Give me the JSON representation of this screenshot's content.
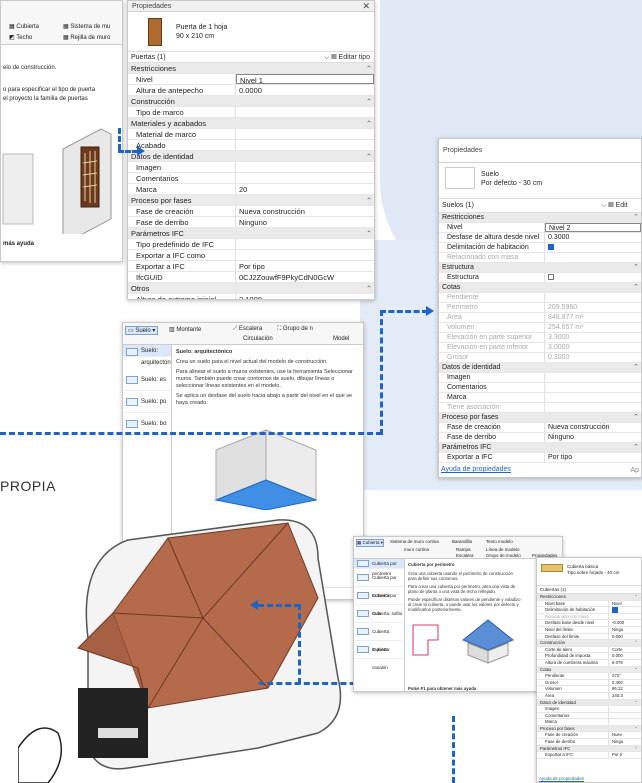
{
  "background": {
    "accent": "#1e63c8",
    "blob": "#dfe8f4"
  },
  "left_partial": {
    "toolbar": {
      "cubierta": "Cubierta",
      "sistema": "Sistema de mu",
      "techo": "Techo",
      "rejilla": "Rejilla de muro"
    },
    "line1": "elo de construcción.",
    "line2": "o para especificar el tipo de puerta",
    "line3": "el proyecto la familia de puertas",
    "help": "más ayuda"
  },
  "door_panel": {
    "title": "Propiedades",
    "type_name": "Puerta de 1 hoja",
    "type_size": "90 x 210 cm",
    "selector": "Puertas (1)",
    "edit_type": "Editar tipo",
    "rows": [
      {
        "g": "Restricciones"
      },
      {
        "k": "Nivel",
        "v": "Nivel 1",
        "edit": true
      },
      {
        "k": "Altura de antepecho",
        "v": "0.0000"
      },
      {
        "g": "Construcción"
      },
      {
        "k": "Tipo de marco",
        "v": ""
      },
      {
        "g": "Materiales y acabados"
      },
      {
        "k": "Material de marco",
        "v": ""
      },
      {
        "k": "Acabado",
        "v": ""
      },
      {
        "g": "Datos de identidad"
      },
      {
        "k": "Imagen",
        "v": ""
      },
      {
        "k": "Comentarios",
        "v": ""
      },
      {
        "k": "Marca",
        "v": "20"
      },
      {
        "g": "Proceso por fases"
      },
      {
        "k": "Fase de creación",
        "v": "Nueva construcción"
      },
      {
        "k": "Fase de derribo",
        "v": "Ninguno"
      },
      {
        "g": "Parámetros IFC"
      },
      {
        "k": "Tipo predefinido de IFC",
        "v": ""
      },
      {
        "k": "Exportar a IFC como",
        "v": ""
      },
      {
        "k": "Exportar a IFC",
        "v": "Por tipo"
      },
      {
        "k": "IfcGUID",
        "v": "0CJ2ZouwfF9PkyCdN0GcW"
      },
      {
        "g": "Otros"
      },
      {
        "k": "Altura de extremo inicial",
        "v": "2.1000"
      }
    ]
  },
  "floor_panel": {
    "title": "Propiedades",
    "type_name": "Suelo",
    "type_sub": "Por defecto - 30 cm",
    "selector": "Suelos (1)",
    "edit_type": "Edit",
    "rows": [
      {
        "g": "Restricciones"
      },
      {
        "k": "Nivel",
        "v": "Nivel 2",
        "edit": true
      },
      {
        "k": "Desfase de altura desde nivel",
        "v": "0.3000"
      },
      {
        "k": "Delimitación de habitación",
        "chk": true
      },
      {
        "k": "Relacionado con masa",
        "v": "",
        "dim": true
      },
      {
        "g": "Estructura"
      },
      {
        "k": "Estructura",
        "chk": false
      },
      {
        "g": "Cotas"
      },
      {
        "k": "Pendiente",
        "v": "",
        "dim": true
      },
      {
        "k": "Perímetro",
        "v": "209.5960",
        "dim": true
      },
      {
        "k": "Área",
        "v": "848.877 m²",
        "dim": true
      },
      {
        "k": "Volumen",
        "v": "254.657 m³",
        "dim": true
      },
      {
        "k": "Elevación en parte superior",
        "v": "3.3000",
        "dim": true
      },
      {
        "k": "Elevación en parte inferior",
        "v": "3.0000",
        "dim": true
      },
      {
        "k": "Grosor",
        "v": "0.3000",
        "dim": true
      },
      {
        "g": "Datos de identidad"
      },
      {
        "k": "Imagen",
        "v": ""
      },
      {
        "k": "Comentarios",
        "v": ""
      },
      {
        "k": "Marca",
        "v": ""
      },
      {
        "k": "Tiene asociación",
        "v": "",
        "dim": true
      },
      {
        "g": "Proceso por fases"
      },
      {
        "k": "Fase de creación",
        "v": "Nueva construcción"
      },
      {
        "k": "Fase de derribo",
        "v": "Ninguno"
      },
      {
        "g": "Parámetros IFC"
      },
      {
        "k": "Exportar a IFC",
        "v": "Por tipo"
      }
    ],
    "help_link": "Ayuda de propiedades",
    "apply": "Ap"
  },
  "floor_tool": {
    "toolbar": {
      "suelo": "Suelo",
      "montante": "Montante",
      "escalera": "Escalera",
      "grupo": "Grupo de n",
      "circulacion": "Circulación",
      "model": "Model"
    },
    "menu": [
      "Suelo: arquitectónico",
      "Suelo: es",
      "Suelo: po",
      "Suelo: bo"
    ],
    "tip_title": "Suelo: arquitectónico",
    "tip_p1": "Crea un suelo para el nivel actual del modelo de construcción.",
    "tip_p2": "Para alinear el suelo a muros existentes, use la herramienta Seleccionar muros. También puede crear contornos de suelo, dibujar líneas o seleccionar líneas existentes en el modelo.",
    "tip_p3": "Se aplica un desfase del suelo hacia abajo a partir del nivel en el que se haya creado.",
    "tip_footer": "Pulse F1 para obtener más ayuda"
  },
  "roof_tool": {
    "toolbar": {
      "cubierta": "Cubierta",
      "sistema": "Sistema de muro cortina",
      "baranda": "Barandilla",
      "texto": "Texto modelo",
      "rampa": "Rampa",
      "linea": "Línea de modelo",
      "muro": "muro cortina",
      "escalera": "Escalera",
      "grupo": "Grupo de modelo",
      "propiedades": "Propiedades"
    },
    "menu": [
      "Cubierta por perímetro",
      "Cubierta por extrusión",
      "Cubierta por cara",
      "Cubierta: sofito",
      "Cubierta: imposta",
      "Cubierta: canalón"
    ],
    "tip_title": "Cubierta por perímetro",
    "tip_p1": "Crea una cubierta usando el perímetro de construcción para definir sus contornos.",
    "tip_p2": "Para crear una cubierta por perímetro, abra una vista de plano de planta o una vista de techo reflejado.",
    "tip_p3": "Puede especificar distintos valores de pendiente y voladizo al crear la cubierta, o puede usar los valores por defecto y modificarlos posteriormente.",
    "tip_footer": "Pulse F1 para obtener más ayuda"
  },
  "roof_panel": {
    "type_name": "Cubierta básica",
    "type_sub": "Tipo sobre forjado - 40 cm",
    "selector": "Cubiertas (1)",
    "rows": [
      {
        "g": "Restricciones"
      },
      {
        "k": "Nivel base",
        "v": "Nivel"
      },
      {
        "k": "Delimitación de habitación",
        "chk": true
      },
      {
        "k": "Relacionado con masa",
        "v": "",
        "dim": true
      },
      {
        "k": "Desfase base desde nivel",
        "v": "-0.000"
      },
      {
        "k": "Nivel del límite",
        "v": "Ningu"
      },
      {
        "k": "Desfase del límite",
        "v": "0.000"
      },
      {
        "g": "Construcción"
      },
      {
        "k": "Corte de alero",
        "v": "Corte"
      },
      {
        "k": "Profundidad de imposta",
        "v": "0.000"
      },
      {
        "k": "Altura de cumbrera máxima",
        "v": "8.078"
      },
      {
        "g": "Cotas"
      },
      {
        "k": "Pendiente",
        "v": "272°"
      },
      {
        "k": "Grosor",
        "v": "0.400"
      },
      {
        "k": "Volumen",
        "v": "96.12"
      },
      {
        "k": "Área",
        "v": "240.3"
      },
      {
        "g": "Datos de identidad"
      },
      {
        "k": "Imagen",
        "v": ""
      },
      {
        "k": "Comentarios",
        "v": ""
      },
      {
        "k": "Marca",
        "v": ""
      },
      {
        "g": "Proceso por fases"
      },
      {
        "k": "Fase de creación",
        "v": "Nuev"
      },
      {
        "k": "Fase de derribo",
        "v": "Ningu"
      },
      {
        "g": "Parámetros IFC"
      },
      {
        "k": "Exportar a IFC",
        "v": "Por ti"
      }
    ],
    "help_link": "Ayuda de propiedades"
  },
  "caption": "PROPIA"
}
